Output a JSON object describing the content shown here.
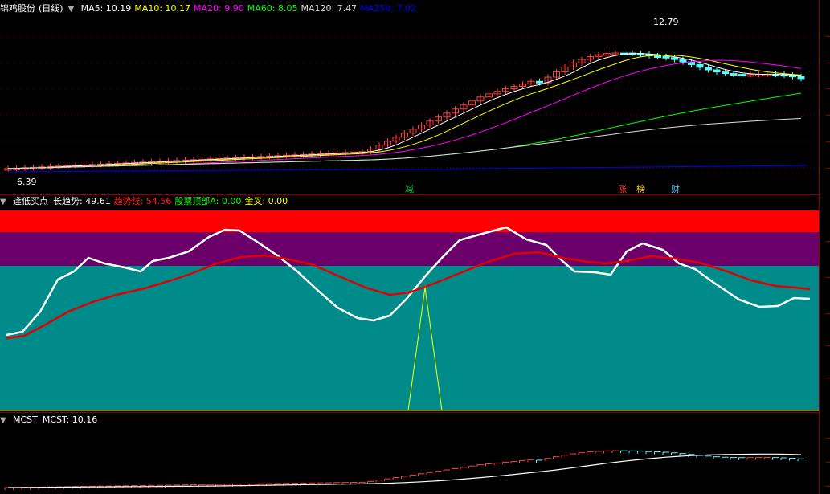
{
  "main_chart": {
    "stock_name": "锦鸡股份",
    "period": "(日线)",
    "ma_items": [
      {
        "label": "MA5: 10.19",
        "color": "#ffffff"
      },
      {
        "label": "MA10: 10.17",
        "color": "#ffff00"
      },
      {
        "label": "MA20: 9.90",
        "color": "#ff00ff"
      },
      {
        "label": "MA60: 8.05",
        "color": "#00ff00"
      },
      {
        "label": "MA120: 7.47",
        "color": "#dddddd"
      },
      {
        "label": "MA250: 7.02",
        "color": "#0000ff"
      }
    ],
    "high_label": "12.79",
    "low_label": "6.39",
    "markers": [
      {
        "text": "减",
        "color": "#00c040"
      },
      {
        "text": "涨",
        "color": "#ff3030"
      },
      {
        "text": "榜",
        "color": "#ffcc00"
      },
      {
        "text": "财",
        "color": "#66ccff"
      }
    ]
  },
  "indicator": {
    "name": "逢低买点",
    "items": [
      {
        "label": "长趋势: 49.61",
        "color": "#ffffff"
      },
      {
        "label": "趋势线: 54.56",
        "color": "#ff2020"
      },
      {
        "label": "股票顶部A: 0.00",
        "color": "#00ff00"
      },
      {
        "label": "金叉: 0.00",
        "color": "#ffff00"
      }
    ]
  },
  "mcst": {
    "name": "MCST",
    "value_label": "MCST: 10.16"
  }
}
